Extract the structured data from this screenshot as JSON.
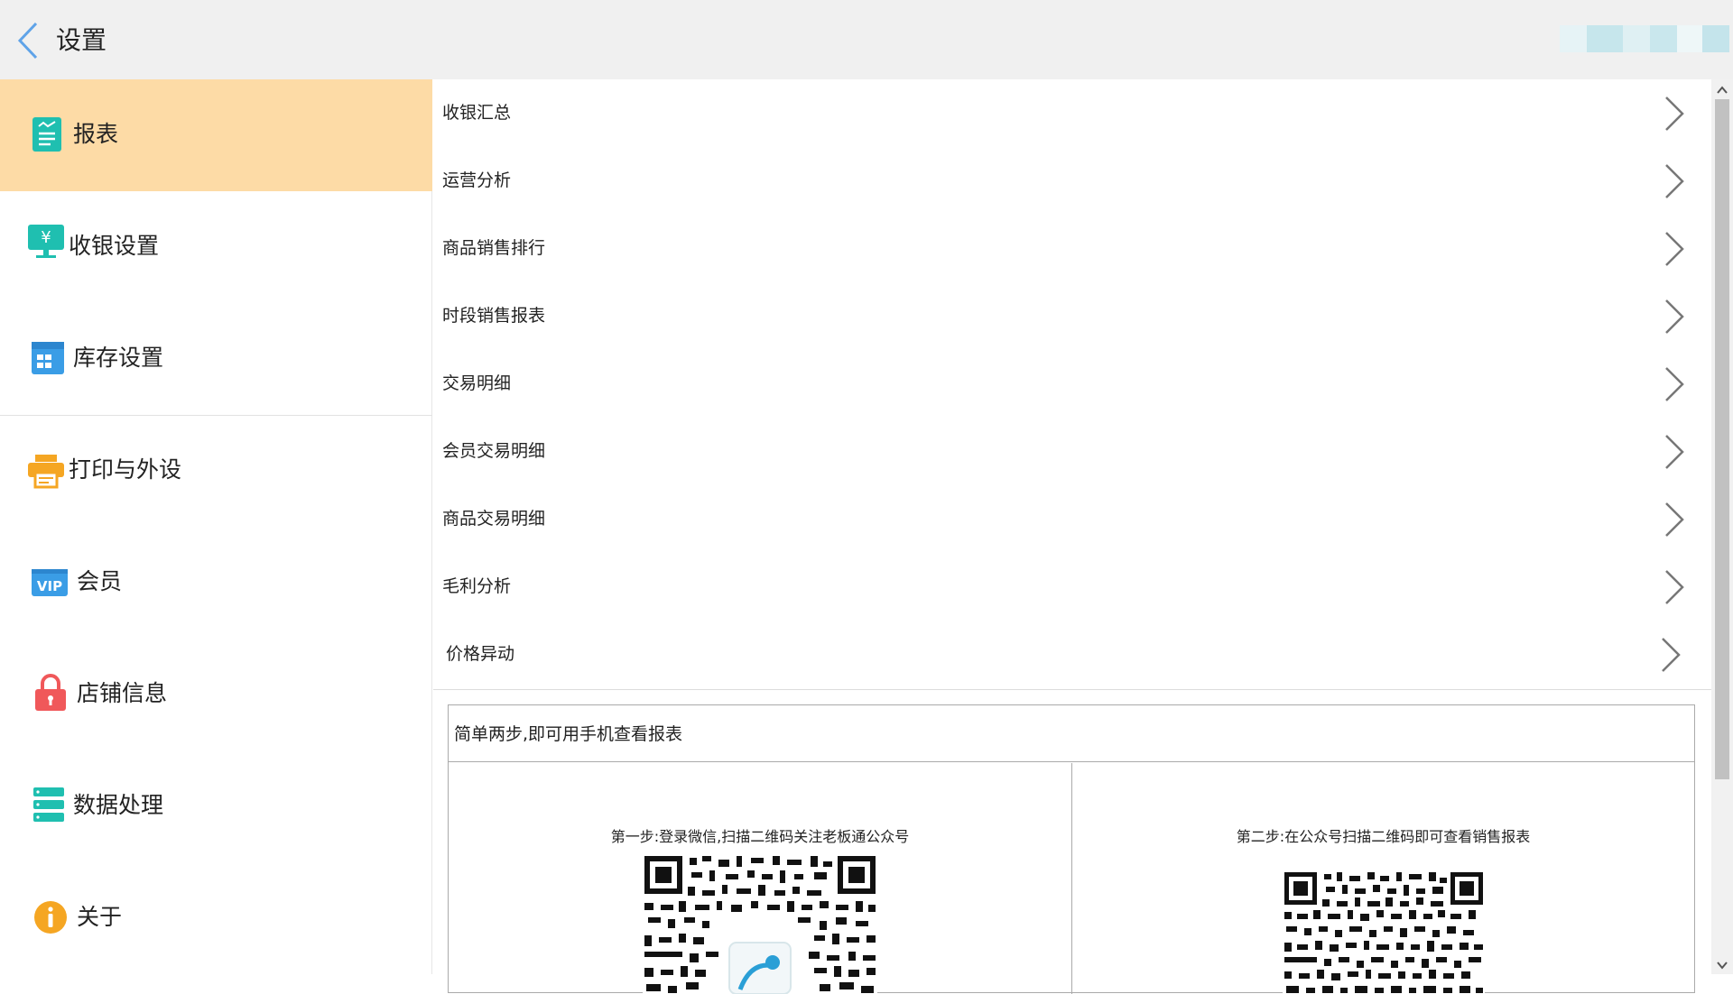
{
  "header": {
    "title": "设置",
    "back_icon": "chevron-left-icon"
  },
  "sidebar": {
    "items": [
      {
        "label": "报表",
        "icon": "report-icon",
        "active": true
      },
      {
        "label": "收银设置",
        "icon": "cash-register-icon"
      },
      {
        "label": "库存设置",
        "icon": "inventory-icon"
      },
      {
        "label": "打印与外设",
        "icon": "printer-icon"
      },
      {
        "label": "会员",
        "icon": "vip-icon"
      },
      {
        "label": "店铺信息",
        "icon": "store-lock-icon"
      },
      {
        "label": "数据处理",
        "icon": "data-icon"
      },
      {
        "label": "关于",
        "icon": "info-icon"
      }
    ]
  },
  "reports": {
    "items": [
      {
        "label": "收银汇总"
      },
      {
        "label": "运营分析"
      },
      {
        "label": "商品销售排行"
      },
      {
        "label": "时段销售报表"
      },
      {
        "label": "交易明细"
      },
      {
        "label": "会员交易明细"
      },
      {
        "label": "商品交易明细"
      },
      {
        "label": "毛利分析"
      },
      {
        "label": "价格异动"
      }
    ]
  },
  "qr_panel": {
    "title": "简单两步,即可用手机查看报表",
    "step1": "第一步:登录微信,扫描二维码关注老板通公众号",
    "step2": "第二步:在公众号扫描二维码即可查看销售报表"
  },
  "colors": {
    "active_bg": "#fddba6",
    "header_bg": "#f0f0f0",
    "teal": "#1fbfb0",
    "blue": "#3a9de6",
    "orange": "#f5a623",
    "red": "#f0585a"
  }
}
